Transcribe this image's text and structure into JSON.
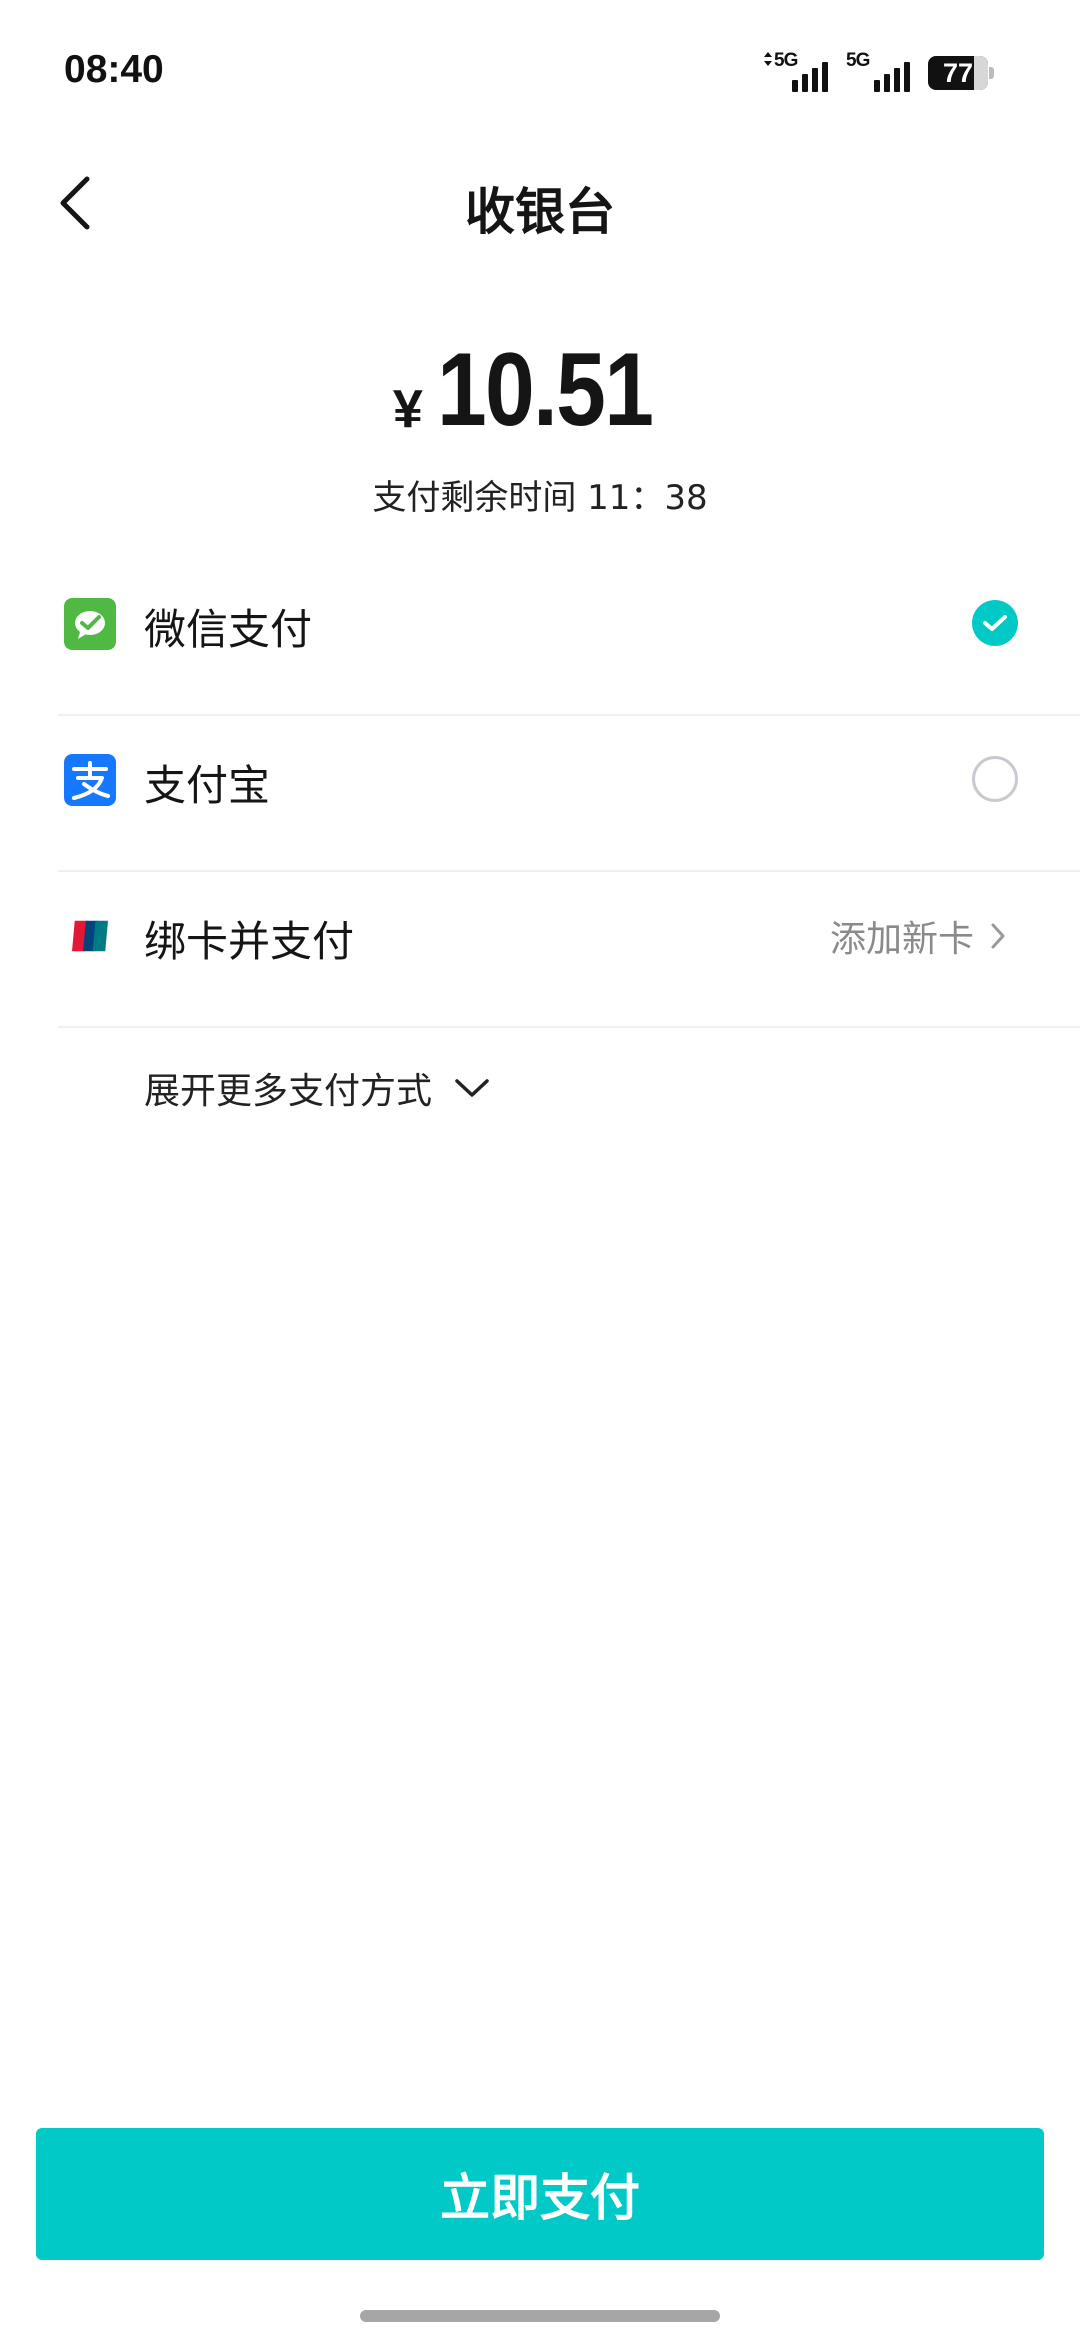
{
  "status_bar": {
    "time": "08:40",
    "network_1": "5G",
    "network_2": "5G",
    "battery": "77"
  },
  "header": {
    "title": "收银台",
    "back_icon": "chevron-left-icon"
  },
  "amount": {
    "currency": "¥",
    "value": "10.51",
    "countdown": "支付剩余时间 11：38"
  },
  "payment_methods": [
    {
      "label": "微信支付",
      "icon": "wechat-pay-icon",
      "selected": true
    },
    {
      "label": "支付宝",
      "icon": "alipay-icon",
      "selected": false
    },
    {
      "label": "绑卡并支付",
      "icon": "unionpay-icon",
      "action": "添加新卡"
    }
  ],
  "expand_more": "展开更多支付方式",
  "pay_button": "立即支付",
  "colors": {
    "accent": "#00c9c7",
    "wechat": "#4fb944",
    "alipay": "#1677ff",
    "unionpay_red": "#e21836",
    "unionpay_blue": "#00447c",
    "unionpay_green": "#007b84"
  }
}
